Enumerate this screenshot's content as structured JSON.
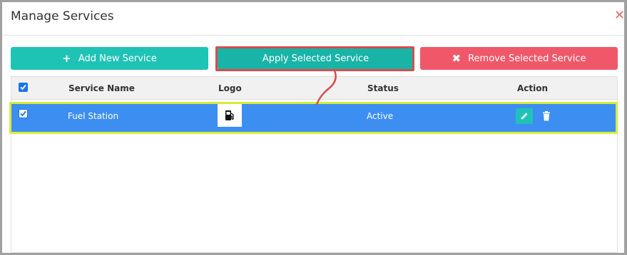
{
  "dialog": {
    "title": "Manage Services",
    "close_symbol": "✕"
  },
  "toolbar": {
    "add_label": "Add New Service",
    "add_icon": "plus-icon",
    "apply_label": "Apply Selected Service",
    "remove_label": "Remove Selected Service",
    "remove_icon": "x-icon"
  },
  "table": {
    "columns": [
      "Service Name",
      "Logo",
      "Status",
      "Action"
    ],
    "header_checked": true,
    "rows": [
      {
        "checked": true,
        "service_name": "Fuel Station",
        "logo_icon": "fuel-pump-icon",
        "status": "Active",
        "actions": [
          "edit-icon",
          "trash-icon"
        ]
      }
    ]
  },
  "colors": {
    "primary_teal": "#1fc3b6",
    "danger_red": "#f05869",
    "selected_row_blue": "#3d8ef1",
    "annotation_red": "#d94c4c",
    "annotation_yellow": "#d6ec3c"
  }
}
